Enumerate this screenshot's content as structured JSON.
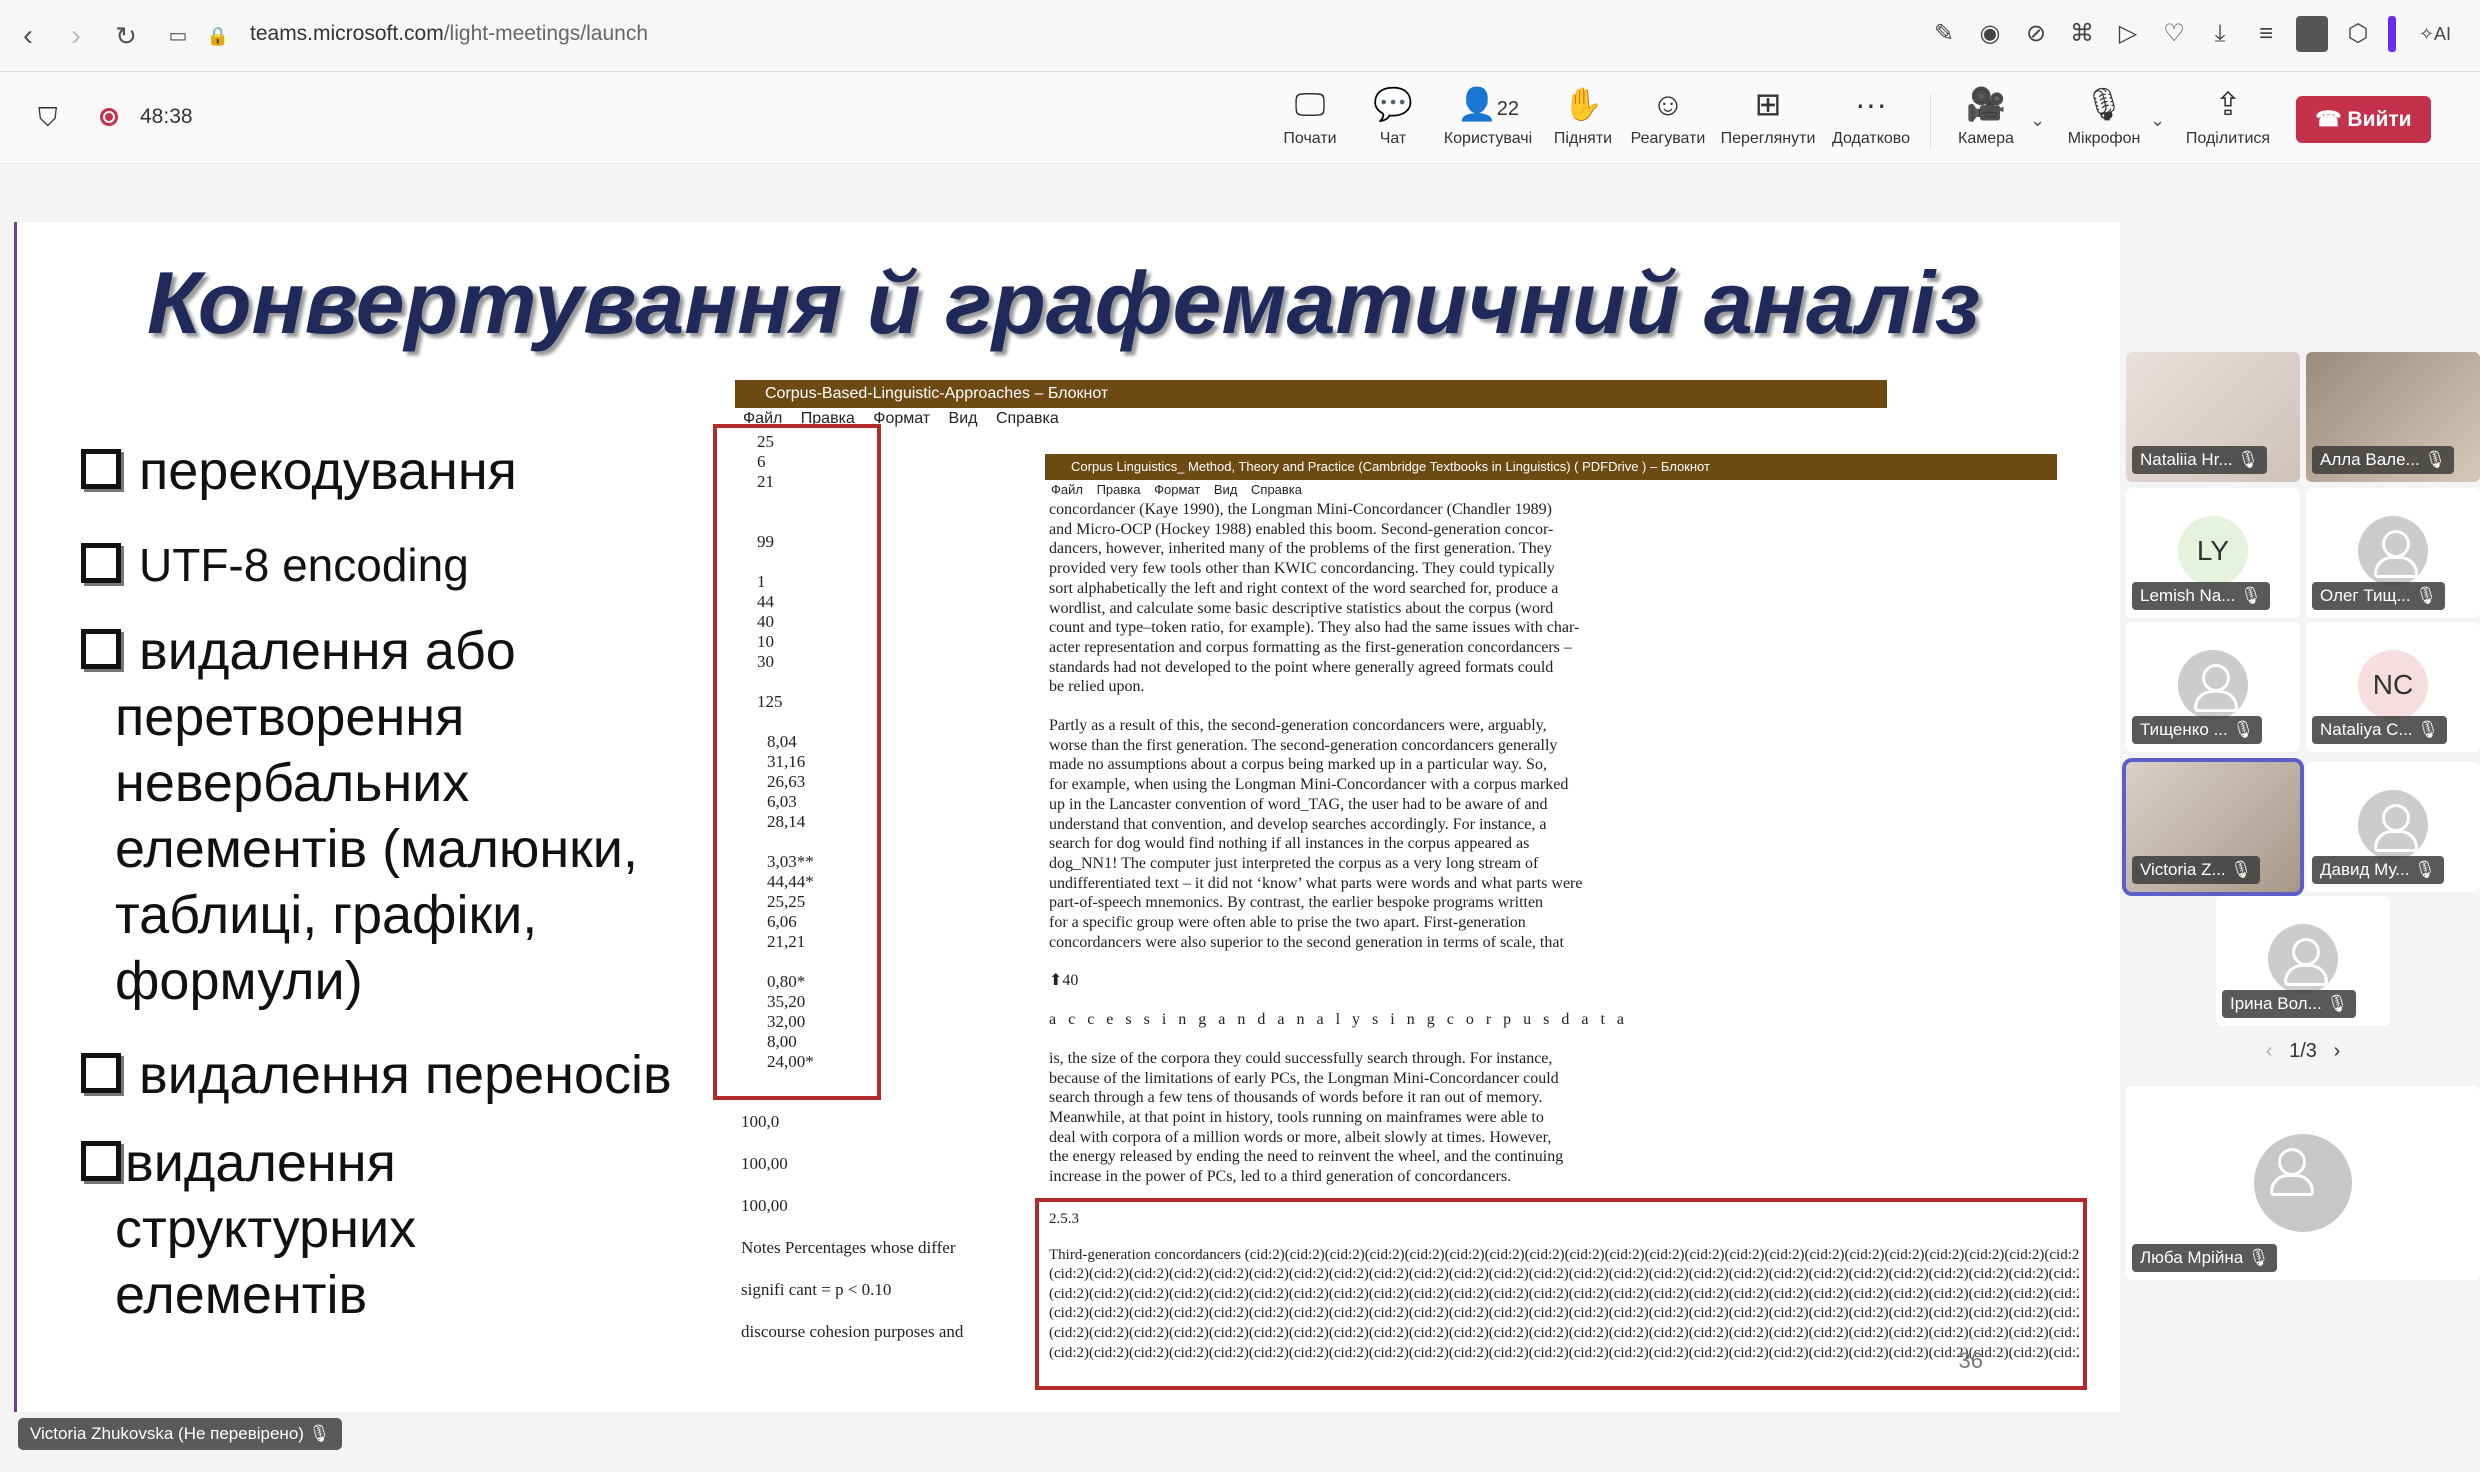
{
  "browser": {
    "url_host": "teams.microsoft.com",
    "url_path": "/light-meetings/launch",
    "ai_label": "AI"
  },
  "meeting": {
    "timer": "48:38",
    "toolbar": [
      {
        "icon": "screen-icon",
        "label": "Почати"
      },
      {
        "icon": "chat-icon",
        "label": "Чат"
      },
      {
        "icon": "people-icon",
        "label": "Користувачі",
        "count": "22"
      },
      {
        "icon": "hand-icon",
        "label": "Підняти"
      },
      {
        "icon": "react-icon",
        "label": "Реагувати"
      },
      {
        "icon": "view-icon",
        "label": "Переглянути"
      },
      {
        "icon": "more-icon",
        "label": "Додатково"
      },
      {
        "icon": "camera-off-icon",
        "label": "Камера"
      },
      {
        "icon": "mic-off-icon",
        "label": "Мікрофон"
      },
      {
        "icon": "share-icon",
        "label": "Поділитися"
      }
    ],
    "leave_label": "Вийти"
  },
  "slide": {
    "title": "Конвертування й графематичний аналіз",
    "bullets": [
      "перекодування",
      "UTF-8 encoding",
      "видалення або",
      "перетворення",
      "невербальних",
      "елементів (малюнки,",
      "таблиці, графіки,",
      "формули)",
      "видалення переносів",
      "видалення",
      "структурних",
      "елементів"
    ],
    "notepad1": {
      "title": "Corpus-Based-Linguistic-Approaches – Блокнот",
      "menu": "Файл Правка Формат Вид Справка",
      "numbers": [
        "25",
        "6",
        "21",
        "",
        "",
        "99",
        "",
        "1",
        "44",
        "40",
        "10",
        "30",
        "",
        "125",
        "",
        "8,04",
        "31,16",
        "26,63",
        "6,03",
        "28,14",
        "",
        "3,03**",
        "44,44*",
        "25,25",
        "6,06",
        "21,21",
        "",
        "0,80*",
        "35,20",
        "32,00",
        "8,00",
        "24,00*"
      ]
    },
    "left_tail": [
      "100,0",
      "100,00",
      "100,00",
      "Notes  Percentages  whose  differ",
      "signifi cant = p < 0.10",
      "discourse cohesion purposes and"
    ],
    "notepad2": {
      "title": "Corpus Linguistics_ Method, Theory and Practice (Cambridge Textbooks in Linguistics) ( PDFDrive ) – Блокнот",
      "menu": "Файл Правка Формат Вид Справка",
      "para1": [
        "concordancer (Kaye 1990), the Longman Mini-Concordancer (Chandler 1989)",
        "and Micro-OCP (Hockey 1988) enabled this boom. Second-generation concor-",
        "dancers, however, inherited many of the problems of the first generation. They",
        "provided very few tools other than KWIC concordancing. They could typically",
        "sort alphabetically the left and right context of the word searched for, produce a",
        "wordlist, and calculate some basic descriptive statistics about the corpus (word",
        "count and type–token ratio, for example). They also had the same issues with char-",
        "acter representation and corpus formatting as the first-generation concordancers –",
        "standards had not developed to the point where generally agreed formats could",
        "be relied upon."
      ],
      "para2": [
        "Partly as a result of this, the second-generation concordancers were, arguably,",
        "worse than the first generation. The second-generation concordancers generally",
        "made no assumptions about a corpus being marked up in a particular way. So,",
        "for example, when using the Longman Mini-Concordancer with a corpus marked",
        "up in the Lancaster convention of word_TAG, the user had to be aware of and",
        "understand that convention, and develop searches accordingly. For instance, a",
        "search for dog would find nothing if all instances in the corpus appeared as",
        "dog_NN1! The computer just interpreted the corpus as a very long stream of",
        "undifferentiated text – it did not ‘know’ what parts were words and what parts were",
        "part-of-speech mnemonics. By contrast, the earlier bespoke programs written",
        "for a specific group were often able to prise the two apart. First-generation",
        "concordancers were also superior to the second generation in terms of scale, that"
      ],
      "page_marker": "40",
      "heading": "a c c e s s i n g a n d a n a l y s i n g c o r p u s d a t a",
      "para3": [
        "is, the size of the corpora they could successfully search through. For instance,",
        "because of the limitations of early PCs, the Longman Mini-Concordancer could",
        "search through a few tens of thousands of words before it ran out of memory.",
        "Meanwhile, at that point in history, tools running on mainframes were able to",
        "deal with corpora of a million words or more, albeit slowly at times. However,",
        "the energy released by ending the need to reinvent the wheel, and the continuing",
        "increase in the power of PCs, led to a third generation of concordancers."
      ],
      "section": "2.5.3",
      "cid_first": "Third-generation concordancers (cid:2)(cid:2)(cid:2)(cid:2)(cid:2)(cid:2)(cid:2)(cid:2)(cid:2)(cid:2)(cid:2)(cid:2)(cid:2)(cid:2)(cid:2)(cid:2)(cid:2)(cid:2)(cid:2)(cid:2)(cid:2)(cid:2)(c",
      "cid_line": "(cid:2)(cid:2)(cid:2)(cid:2)(cid:2)(cid:2)(cid:2)(cid:2)(cid:2)(cid:2)(cid:2)(cid:2)(cid:2)(cid:2)(cid:2)(cid:2)(cid:2)(cid:2)(cid:2)(cid:2)(cid:2)(cid:2)(cid:2)(cid:2)(cid:2)(cid:2)(cid:2)(cid:2)(cid:2)(cid:2)(c",
      "page_number": "36"
    }
  },
  "speaker_label": "Victoria Zhukovska (Не перевірено)",
  "participants": [
    {
      "name": "Nataliia Hr...",
      "type": "photo"
    },
    {
      "name": "Алла Вале...",
      "type": "photo"
    },
    {
      "name": "Lemish Na...",
      "type": "initials",
      "initials": "LY",
      "color": "#e6f2dc"
    },
    {
      "name": "Олег Тищ...",
      "type": "avatar"
    },
    {
      "name": "Тищенко ...",
      "type": "avatar"
    },
    {
      "name": "Nataliya C...",
      "type": "initials",
      "initials": "NC",
      "color": "#f6dde0"
    },
    {
      "name": "Victoria Z...",
      "type": "photo"
    },
    {
      "name": "Давид Му...",
      "type": "avatar"
    },
    {
      "name": "Ірина Вол...",
      "type": "avatar"
    }
  ],
  "pager": "1/3",
  "big_tile": "Люба Мрійна"
}
